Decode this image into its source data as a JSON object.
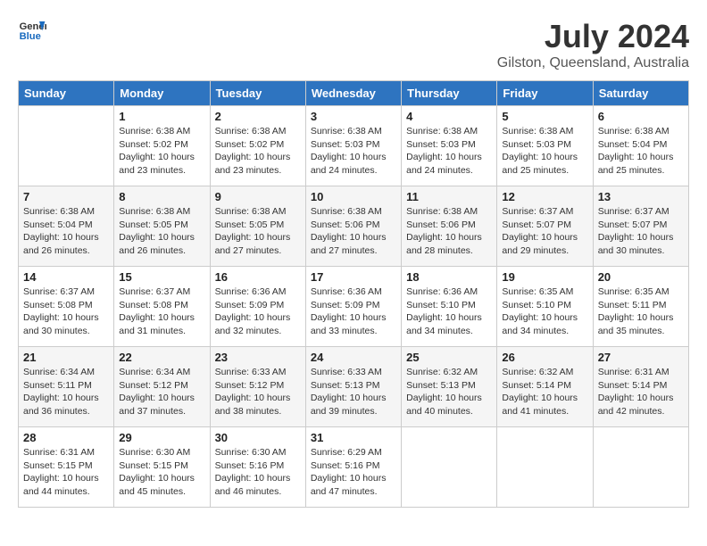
{
  "header": {
    "logo_line1": "General",
    "logo_line2": "Blue",
    "month_year": "July 2024",
    "location": "Gilston, Queensland, Australia"
  },
  "days_of_week": [
    "Sunday",
    "Monday",
    "Tuesday",
    "Wednesday",
    "Thursday",
    "Friday",
    "Saturday"
  ],
  "weeks": [
    [
      {
        "day": "",
        "sunrise": "",
        "sunset": "",
        "daylight": ""
      },
      {
        "day": "1",
        "sunrise": "Sunrise: 6:38 AM",
        "sunset": "Sunset: 5:02 PM",
        "daylight": "Daylight: 10 hours and 23 minutes."
      },
      {
        "day": "2",
        "sunrise": "Sunrise: 6:38 AM",
        "sunset": "Sunset: 5:02 PM",
        "daylight": "Daylight: 10 hours and 23 minutes."
      },
      {
        "day": "3",
        "sunrise": "Sunrise: 6:38 AM",
        "sunset": "Sunset: 5:03 PM",
        "daylight": "Daylight: 10 hours and 24 minutes."
      },
      {
        "day": "4",
        "sunrise": "Sunrise: 6:38 AM",
        "sunset": "Sunset: 5:03 PM",
        "daylight": "Daylight: 10 hours and 24 minutes."
      },
      {
        "day": "5",
        "sunrise": "Sunrise: 6:38 AM",
        "sunset": "Sunset: 5:03 PM",
        "daylight": "Daylight: 10 hours and 25 minutes."
      },
      {
        "day": "6",
        "sunrise": "Sunrise: 6:38 AM",
        "sunset": "Sunset: 5:04 PM",
        "daylight": "Daylight: 10 hours and 25 minutes."
      }
    ],
    [
      {
        "day": "7",
        "sunrise": "Sunrise: 6:38 AM",
        "sunset": "Sunset: 5:04 PM",
        "daylight": "Daylight: 10 hours and 26 minutes."
      },
      {
        "day": "8",
        "sunrise": "Sunrise: 6:38 AM",
        "sunset": "Sunset: 5:05 PM",
        "daylight": "Daylight: 10 hours and 26 minutes."
      },
      {
        "day": "9",
        "sunrise": "Sunrise: 6:38 AM",
        "sunset": "Sunset: 5:05 PM",
        "daylight": "Daylight: 10 hours and 27 minutes."
      },
      {
        "day": "10",
        "sunrise": "Sunrise: 6:38 AM",
        "sunset": "Sunset: 5:06 PM",
        "daylight": "Daylight: 10 hours and 27 minutes."
      },
      {
        "day": "11",
        "sunrise": "Sunrise: 6:38 AM",
        "sunset": "Sunset: 5:06 PM",
        "daylight": "Daylight: 10 hours and 28 minutes."
      },
      {
        "day": "12",
        "sunrise": "Sunrise: 6:37 AM",
        "sunset": "Sunset: 5:07 PM",
        "daylight": "Daylight: 10 hours and 29 minutes."
      },
      {
        "day": "13",
        "sunrise": "Sunrise: 6:37 AM",
        "sunset": "Sunset: 5:07 PM",
        "daylight": "Daylight: 10 hours and 30 minutes."
      }
    ],
    [
      {
        "day": "14",
        "sunrise": "Sunrise: 6:37 AM",
        "sunset": "Sunset: 5:08 PM",
        "daylight": "Daylight: 10 hours and 30 minutes."
      },
      {
        "day": "15",
        "sunrise": "Sunrise: 6:37 AM",
        "sunset": "Sunset: 5:08 PM",
        "daylight": "Daylight: 10 hours and 31 minutes."
      },
      {
        "day": "16",
        "sunrise": "Sunrise: 6:36 AM",
        "sunset": "Sunset: 5:09 PM",
        "daylight": "Daylight: 10 hours and 32 minutes."
      },
      {
        "day": "17",
        "sunrise": "Sunrise: 6:36 AM",
        "sunset": "Sunset: 5:09 PM",
        "daylight": "Daylight: 10 hours and 33 minutes."
      },
      {
        "day": "18",
        "sunrise": "Sunrise: 6:36 AM",
        "sunset": "Sunset: 5:10 PM",
        "daylight": "Daylight: 10 hours and 34 minutes."
      },
      {
        "day": "19",
        "sunrise": "Sunrise: 6:35 AM",
        "sunset": "Sunset: 5:10 PM",
        "daylight": "Daylight: 10 hours and 34 minutes."
      },
      {
        "day": "20",
        "sunrise": "Sunrise: 6:35 AM",
        "sunset": "Sunset: 5:11 PM",
        "daylight": "Daylight: 10 hours and 35 minutes."
      }
    ],
    [
      {
        "day": "21",
        "sunrise": "Sunrise: 6:34 AM",
        "sunset": "Sunset: 5:11 PM",
        "daylight": "Daylight: 10 hours and 36 minutes."
      },
      {
        "day": "22",
        "sunrise": "Sunrise: 6:34 AM",
        "sunset": "Sunset: 5:12 PM",
        "daylight": "Daylight: 10 hours and 37 minutes."
      },
      {
        "day": "23",
        "sunrise": "Sunrise: 6:33 AM",
        "sunset": "Sunset: 5:12 PM",
        "daylight": "Daylight: 10 hours and 38 minutes."
      },
      {
        "day": "24",
        "sunrise": "Sunrise: 6:33 AM",
        "sunset": "Sunset: 5:13 PM",
        "daylight": "Daylight: 10 hours and 39 minutes."
      },
      {
        "day": "25",
        "sunrise": "Sunrise: 6:32 AM",
        "sunset": "Sunset: 5:13 PM",
        "daylight": "Daylight: 10 hours and 40 minutes."
      },
      {
        "day": "26",
        "sunrise": "Sunrise: 6:32 AM",
        "sunset": "Sunset: 5:14 PM",
        "daylight": "Daylight: 10 hours and 41 minutes."
      },
      {
        "day": "27",
        "sunrise": "Sunrise: 6:31 AM",
        "sunset": "Sunset: 5:14 PM",
        "daylight": "Daylight: 10 hours and 42 minutes."
      }
    ],
    [
      {
        "day": "28",
        "sunrise": "Sunrise: 6:31 AM",
        "sunset": "Sunset: 5:15 PM",
        "daylight": "Daylight: 10 hours and 44 minutes."
      },
      {
        "day": "29",
        "sunrise": "Sunrise: 6:30 AM",
        "sunset": "Sunset: 5:15 PM",
        "daylight": "Daylight: 10 hours and 45 minutes."
      },
      {
        "day": "30",
        "sunrise": "Sunrise: 6:30 AM",
        "sunset": "Sunset: 5:16 PM",
        "daylight": "Daylight: 10 hours and 46 minutes."
      },
      {
        "day": "31",
        "sunrise": "Sunrise: 6:29 AM",
        "sunset": "Sunset: 5:16 PM",
        "daylight": "Daylight: 10 hours and 47 minutes."
      },
      {
        "day": "",
        "sunrise": "",
        "sunset": "",
        "daylight": ""
      },
      {
        "day": "",
        "sunrise": "",
        "sunset": "",
        "daylight": ""
      },
      {
        "day": "",
        "sunrise": "",
        "sunset": "",
        "daylight": ""
      }
    ]
  ]
}
